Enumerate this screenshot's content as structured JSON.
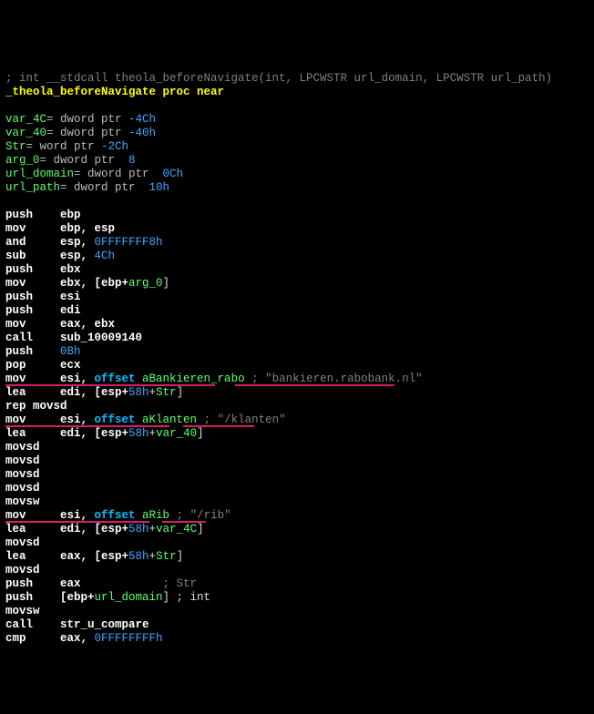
{
  "sig_comment": "; int __stdcall theola_beforeNavigate(int, LPCWSTR url_domain, LPCWSTR url_path)",
  "proc_decl": "_theola_beforeNavigate proc near",
  "blank": "",
  "vars": {
    "v1": {
      "name": "var_4C",
      "rest": "= dword ptr ",
      "off": "-4Ch"
    },
    "v2": {
      "name": "var_40",
      "rest": "= dword ptr ",
      "off": "-40h"
    },
    "v3": {
      "name": "Str",
      "rest": "= word ptr ",
      "off": "-2Ch"
    },
    "v4": {
      "name": "arg_0",
      "rest": "= dword ptr  ",
      "off": "8"
    },
    "v5": {
      "name": "url_domain",
      "rest": "= dword ptr  ",
      "off": "0Ch"
    },
    "v6": {
      "name": "url_path",
      "rest": "= dword ptr  ",
      "off": "10h"
    }
  },
  "i": {
    "push_ebp": "push    ebp",
    "mov_ebpesp": "mov     ebp, esp",
    "and_esp": {
      "a": "and     esp, ",
      "h": "0FFFFFFF8h"
    },
    "sub_esp": {
      "a": "sub     esp, ",
      "h": "4Ch"
    },
    "push_ebx": "push    ebx",
    "mov_ebx": {
      "a": "mov     ebx, [ebp+",
      "v": "arg_0",
      "c": "]"
    },
    "push_esi": "push    esi",
    "push_edi": "push    edi",
    "mov_eaxebx": "mov     eax, ebx",
    "call_sub": {
      "a": "call    ",
      "f": "sub_10009140"
    },
    "push_0b": {
      "a": "push    ",
      "h": "0Bh"
    },
    "pop_ecx": "pop     ecx",
    "mov_esi_bank": {
      "a": "mov     esi, ",
      "k": "offset ",
      "s": "aBankieren_rabo ",
      "c": "; \"bankieren.rabobank.nl\""
    },
    "lea_str": {
      "a": "lea     edi, [esp+",
      "h": "58h",
      "p": "+",
      "v": "Str",
      "c": "]"
    },
    "rep_movsd": "rep movsd",
    "mov_esi_klanten": {
      "a": "mov     esi, ",
      "k": "offset ",
      "s": "aKlanten ",
      "c": "; \"/klanten\""
    },
    "lea_v40": {
      "a": "lea     edi, [esp+",
      "h": "58h",
      "p": "+",
      "v": "var_40",
      "c": "]"
    },
    "movsd1": "movsd",
    "movsd2": "movsd",
    "movsd3": "movsd",
    "movsd4": "movsd",
    "movsw1": "movsw",
    "mov_esi_rib": {
      "a": "mov     esi, ",
      "k": "offset ",
      "s": "aRib ",
      "c": "; \"/rib\""
    },
    "lea_v4c": {
      "a": "lea     edi, [esp+",
      "h": "58h",
      "p": "+",
      "v": "var_4C",
      "c": "]"
    },
    "movsd5": "movsd",
    "lea_eax": {
      "a": "lea     eax, [esp+",
      "h": "58h",
      "p": "+",
      "v": "Str",
      "c": "]"
    },
    "movsd6": "movsd",
    "push_eax": {
      "a": "push    eax            ",
      "c": "; Str"
    },
    "push_urld": {
      "a": "push    [ebp+",
      "v": "url_domain",
      "c": "] ; int"
    },
    "movsw2": "movsw",
    "call_cmp": {
      "a": "call    ",
      "f": "str_u_compare"
    },
    "cmp_eax": {
      "a": "cmp     eax, ",
      "h": "0FFFFFFFFh"
    }
  }
}
